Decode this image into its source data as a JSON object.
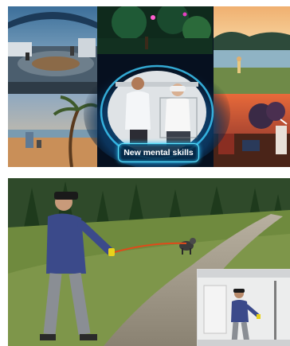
{
  "top_panel": {
    "badge_label": "New mental skills",
    "badge_color": "#5fe6ff",
    "tiles": [
      "platform-scene",
      "forest-scene",
      "lake-scene",
      "beach-scene",
      "sunset-scene"
    ]
  },
  "bottom_panel": {
    "scene": "vr-hiking-path",
    "inset": "lab-setup-photo"
  }
}
